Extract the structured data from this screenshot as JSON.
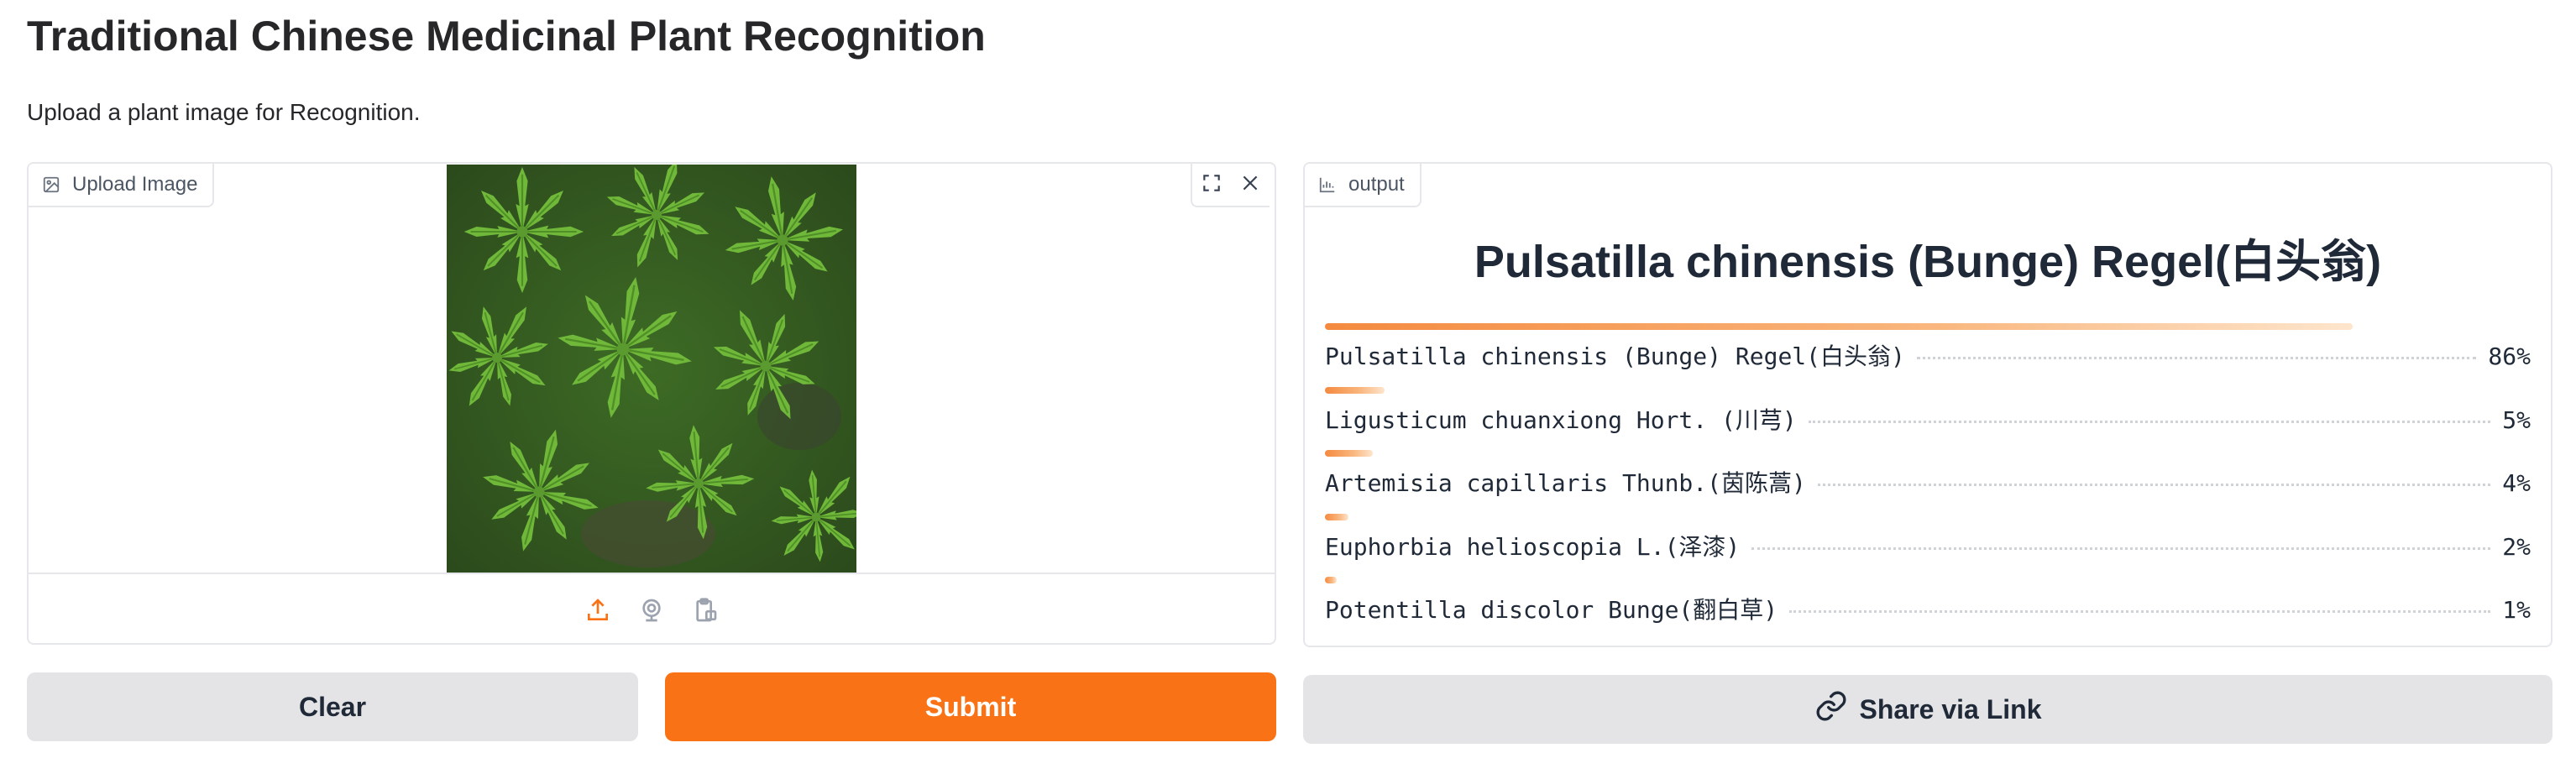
{
  "page": {
    "title": "Traditional Chinese Medicinal Plant Recognition",
    "description": "Upload a plant image for Recognition."
  },
  "input": {
    "label": "Upload Image",
    "label_icon": "image-icon",
    "tools": [
      "fullscreen-icon",
      "close-icon"
    ],
    "sources": [
      "upload-icon",
      "webcam-icon",
      "clipboard-icon"
    ]
  },
  "output": {
    "label": "output",
    "label_icon": "bar-chart-icon",
    "top_label": "Pulsatilla chinensis (Bunge) Regel(白头翁)",
    "confidences": [
      {
        "label": "Pulsatilla chinensis (Bunge) Regel(白头翁)",
        "value": 0.86,
        "display": "86%"
      },
      {
        "label": "Ligusticum chuanxiong Hort. (川芎)",
        "value": 0.05,
        "display": "5%"
      },
      {
        "label": "Artemisia capillaris Thunb.(茵陈蒿)",
        "value": 0.04,
        "display": "4%"
      },
      {
        "label": "Euphorbia helioscopia L.(泽漆)",
        "value": 0.02,
        "display": "2%"
      },
      {
        "label": "Potentilla discolor Bunge(翻白草)",
        "value": 0.01,
        "display": "1%"
      }
    ]
  },
  "buttons": {
    "clear": "Clear",
    "submit": "Submit",
    "share": "Share via Link",
    "share_icon": "link-icon"
  },
  "colors": {
    "accent": "#f97316",
    "secondary_button": "#e4e4e7",
    "border": "#e5e7eb"
  }
}
